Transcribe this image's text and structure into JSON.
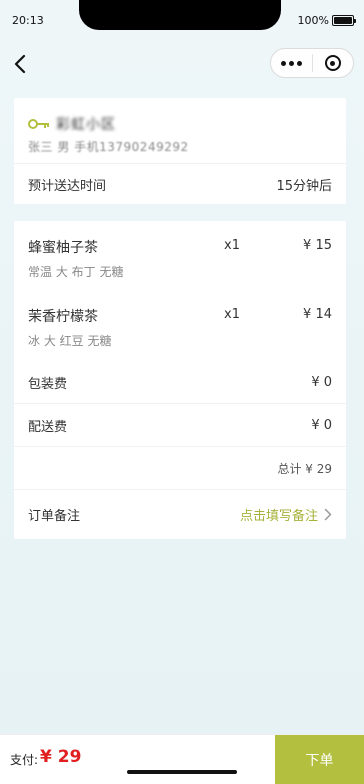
{
  "status_bar": {
    "time": "20:13",
    "battery": "100%"
  },
  "address": {
    "line": "彩虹小区",
    "contact": "张三 男 手机13790249292"
  },
  "eta": {
    "label": "预计送达时间",
    "value": "15分钟后"
  },
  "items": [
    {
      "name": "蜂蜜柚子茶",
      "qty": "x1",
      "price": "¥ 15",
      "spec": "常温 大 布丁 无糖"
    },
    {
      "name": "茉香柠檬茶",
      "qty": "x1",
      "price": "¥ 14",
      "spec": "冰 大 红豆 无糖"
    }
  ],
  "fees": {
    "packing": {
      "label": "包装费",
      "value": "¥ 0"
    },
    "delivery": {
      "label": "配送费",
      "value": "¥ 0"
    }
  },
  "total": "总计 ¥ 29",
  "remark": {
    "label": "订单备注",
    "hint": "点击填写备注"
  },
  "bottom": {
    "pay_label": "支付:",
    "pay_amount": "¥ 29",
    "submit_label": "下单"
  },
  "colors": {
    "accent": "#b2bf3f",
    "price_red": "#e02020",
    "hint": "#a6b23a"
  }
}
